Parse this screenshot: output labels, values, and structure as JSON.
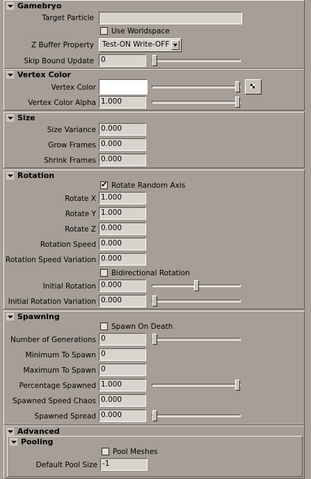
{
  "sections": {
    "gamebryo": {
      "title": "Gamebryo",
      "target_particle_label": "Target Particle",
      "target_particle_value": "",
      "use_worldspace_label": "Use Worldspace",
      "use_worldspace_checked": false,
      "zbuffer_label": "Z Buffer Property",
      "zbuffer_value": "Test-ON Write-OFF",
      "skip_bound_label": "Skip Bound Update",
      "skip_bound_value": "0",
      "skip_bound_fraction": 0.0
    },
    "vertex_color": {
      "title": "Vertex Color",
      "color_label": "Vertex Color",
      "color_value": "#ffffff",
      "color_slider_fraction": 1.0,
      "alpha_label": "Vertex Color Alpha",
      "alpha_value": "1.000",
      "alpha_slider_fraction": 1.0
    },
    "size": {
      "title": "Size",
      "size_variance_label": "Size Variance",
      "size_variance_value": "0.000",
      "grow_frames_label": "Grow Frames",
      "grow_frames_value": "0.000",
      "shrink_frames_label": "Shrink Frames",
      "shrink_frames_value": "0.000"
    },
    "rotation": {
      "title": "Rotation",
      "rotate_random_label": "Rotate Random Axis",
      "rotate_random_checked": true,
      "rotate_x_label": "Rotate X",
      "rotate_x_value": "1.000",
      "rotate_y_label": "Rotate Y",
      "rotate_y_value": "1.000",
      "rotate_z_label": "Rotate Z",
      "rotate_z_value": "0.000",
      "rotation_speed_label": "Rotation Speed",
      "rotation_speed_value": "0.000",
      "rotation_speed_var_label": "Rotation Speed Variation",
      "rotation_speed_var_value": "0.000",
      "bidirectional_label": "Bidirectional Rotation",
      "bidirectional_checked": false,
      "initial_rotation_label": "Initial Rotation",
      "initial_rotation_value": "0.000",
      "initial_rotation_fraction": 0.5,
      "initial_rotation_var_label": "Initial Rotation Variation",
      "initial_rotation_var_value": "0.000",
      "initial_rotation_var_fraction": 0.0
    },
    "spawning": {
      "title": "Spawning",
      "spawn_on_death_label": "Spawn On Death",
      "spawn_on_death_checked": false,
      "num_generations_label": "Number of Generations",
      "num_generations_value": "0",
      "num_generations_fraction": 0.0,
      "min_spawn_label": "Minimum To Spawn",
      "min_spawn_value": "0",
      "max_spawn_label": "Maximum To Spawn",
      "max_spawn_value": "0",
      "pct_spawned_label": "Percentage Spawned",
      "pct_spawned_value": "1.000",
      "pct_spawned_fraction": 1.0,
      "spawned_speed_chaos_label": "Spawned Speed Chaos",
      "spawned_speed_chaos_value": "0.000",
      "spawned_spread_label": "Spawned Spread",
      "spawned_spread_value": "0.000",
      "spawned_spread_fraction": 0.0
    },
    "advanced": {
      "title": "Advanced"
    },
    "pooling": {
      "title": "Pooling",
      "pool_meshes_label": "Pool Meshes",
      "pool_meshes_checked": false,
      "default_pool_size_label": "Default Pool Size",
      "default_pool_size_value": "-1"
    }
  },
  "icons": {
    "collapse": "chevron-down-icon",
    "color_picker": "color-picker-icon",
    "checkmark": "✔"
  },
  "colors": {
    "panel_bg": "#a69e97",
    "field_bg": "#d9d3cd"
  }
}
